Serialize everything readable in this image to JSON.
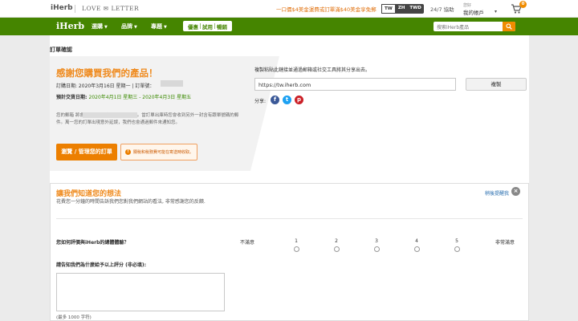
{
  "topbar": {
    "logo_small": "iHerb",
    "love_letter": "LOVE ✉ LETTER",
    "promo": "一口價$4美金運費或訂單滿$40美金享免郵",
    "languages": [
      "TW",
      "ZH",
      "TWD"
    ],
    "help": "24/7 協助",
    "hello": "您好",
    "account": "我的帳戶",
    "cart_count": "0",
    "icons": [
      "cart-icon",
      "chevron-down-icon"
    ]
  },
  "nav": {
    "logo": "iHerb",
    "items": [
      "選購",
      "品牌",
      "專題"
    ],
    "pills": [
      "優惠",
      "試用",
      "暢銷"
    ],
    "search_placeholder": "搜索iHerb產品",
    "accent": "#458500"
  },
  "main": {
    "page_title": "訂單確認",
    "thanks": "感謝您購買我們的產品！",
    "order_line": "訂購日期: 2020年3月16日 星期一 | 訂單號：",
    "delivery_label": "預計交貨日期:",
    "delivery_value": "2020年4月1日 星期三 - 2020年4月3日 星期五",
    "email_text": "您的郵箱                                    將會收到一封確認您訂單的郵件。當訂單出庫時您會收到另外一封含有跟單號碼的郵件。萬一您的訂單出現意外延誤，我們也會通過郵件來通知您。",
    "manage_button": "瀏覽 / 管理您的訂單",
    "notice": "關稅和稅務費可能在寄送時收取。",
    "orange": "#ef8a1d"
  },
  "share": {
    "label": "複製粘貼此鏈接並通過郵箱或社交工具將其分享出去。",
    "url": "https://tw.iherb.com",
    "copy_button": "複製",
    "share_label": "分享:",
    "icons": [
      "facebook-icon",
      "twitter-icon",
      "pinterest-icon"
    ]
  },
  "survey": {
    "title": "讓我們知道您的想法",
    "subtitle": "花費您一分鐘的時間告訴我們您對我們網站的看法, 非常感謝您的反饋.",
    "later": "稍後提醒我",
    "q1": "您如何評價與iHerb的總體體驗？",
    "scale_low": "不滿意",
    "scale_high": "非常滿意",
    "scale": [
      "1",
      "2",
      "3",
      "4",
      "5"
    ],
    "q2": "請告知我們為什麼給予以上評分 (非必填):",
    "max_chars": "(最多 1000 字符)"
  }
}
